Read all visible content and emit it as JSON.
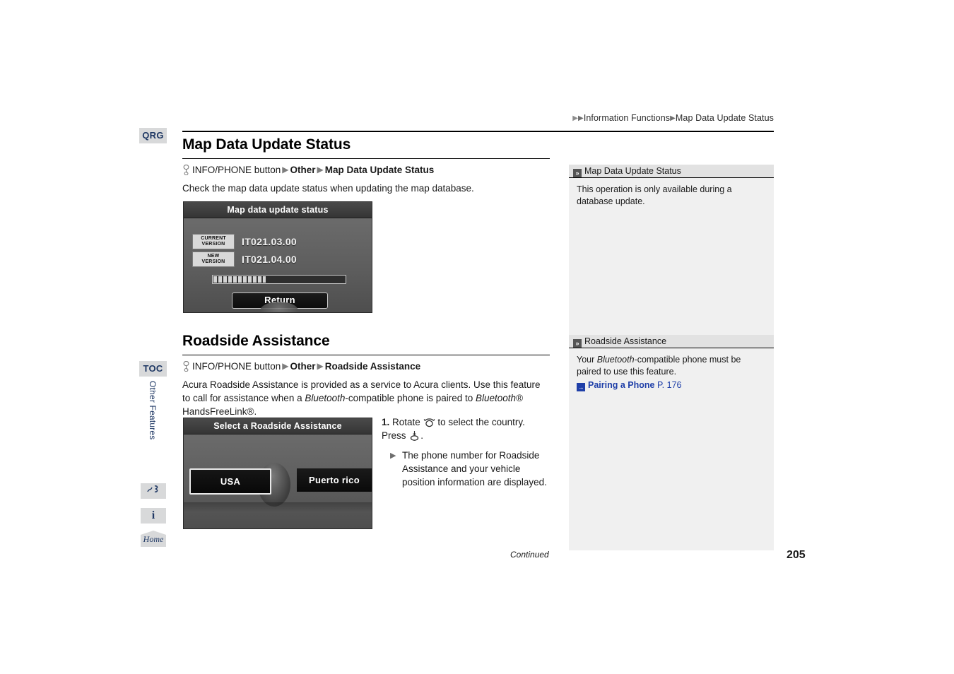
{
  "breadcrumb": {
    "arrow_glyph": "▶",
    "item1": "Information Functions",
    "item2": "Map Data Update Status"
  },
  "margin_tabs": {
    "qrg": "QRG",
    "toc": "TOC",
    "vertical_label": "Other Features",
    "voice_icon_glyph": "Ⓥ",
    "info_icon_glyph": "i",
    "home_label": "Home"
  },
  "sections": [
    {
      "title": "Map Data Update Status",
      "navpath": {
        "button": "INFO/PHONE button",
        "arrow_glyph": "▶",
        "step1": "Other",
        "step2": "Map Data Update Status"
      },
      "description": "Check the map data update status when updating the map database."
    },
    {
      "title": "Roadside Assistance",
      "navpath": {
        "button": "INFO/PHONE button",
        "arrow_glyph": "▶",
        "step1": "Other",
        "step2": "Roadside Assistance"
      },
      "description_part1": "Acura Roadside Assistance is provided as a service to Acura clients. Use this feature to call for assistance when a ",
      "description_italic1": "Bluetooth",
      "description_part2": "-compatible phone is paired to ",
      "description_italic2": "Bluetooth",
      "description_part3": "® HandsFreeLink®."
    }
  ],
  "screenshot1": {
    "title": "Map data update status",
    "current_version_label_line1": "CURRENT",
    "current_version_label_line2": "VERSION",
    "current_version_value": "IT021.03.00",
    "new_version_label_line1": "NEW",
    "new_version_label_line2": "VERSION",
    "new_version_value": "IT021.04.00",
    "progress_percent": 40,
    "return_button": "Return"
  },
  "screenshot2": {
    "title": "Select a Roadside Assistance",
    "option_usa": "USA",
    "option_puerto_rico": "Puerto rico",
    "selected_option": "USA"
  },
  "steps": {
    "number": "1.",
    "text_before_rotate": "Rotate",
    "rotate_icon": "rotate-knob-icon",
    "text_after_rotate": "to select the country.",
    "text_press": "Press",
    "press_icon": "press-knob-icon",
    "text_press_end": ".",
    "sub_arrow_glyph": "▶",
    "sub_text": "The phone number for Roadside Assistance and your vehicle position information are displayed."
  },
  "sidebar": {
    "panels": [
      {
        "header_icon_glyph": "»",
        "header": "Map Data Update Status",
        "body": "This operation is only available during a database update."
      },
      {
        "header_icon_glyph": "»",
        "header": "Roadside Assistance",
        "body_part1": "Your ",
        "body_italic": "Bluetooth",
        "body_part2": "-compatible phone must be paired to use this feature.",
        "xref_icon_glyph": "→",
        "xref_title": "Pairing a Phone",
        "xref_page": "P. 176"
      }
    ]
  },
  "footer": {
    "continued": "Continued",
    "page_number": "205"
  },
  "colors": {
    "accent_blue": "#1f3864",
    "link_blue": "#1f3fa8",
    "tab_gray": "#d8d9da",
    "panel_gray": "#f0f0f0",
    "panel_header_gray": "#e2e2e2"
  }
}
